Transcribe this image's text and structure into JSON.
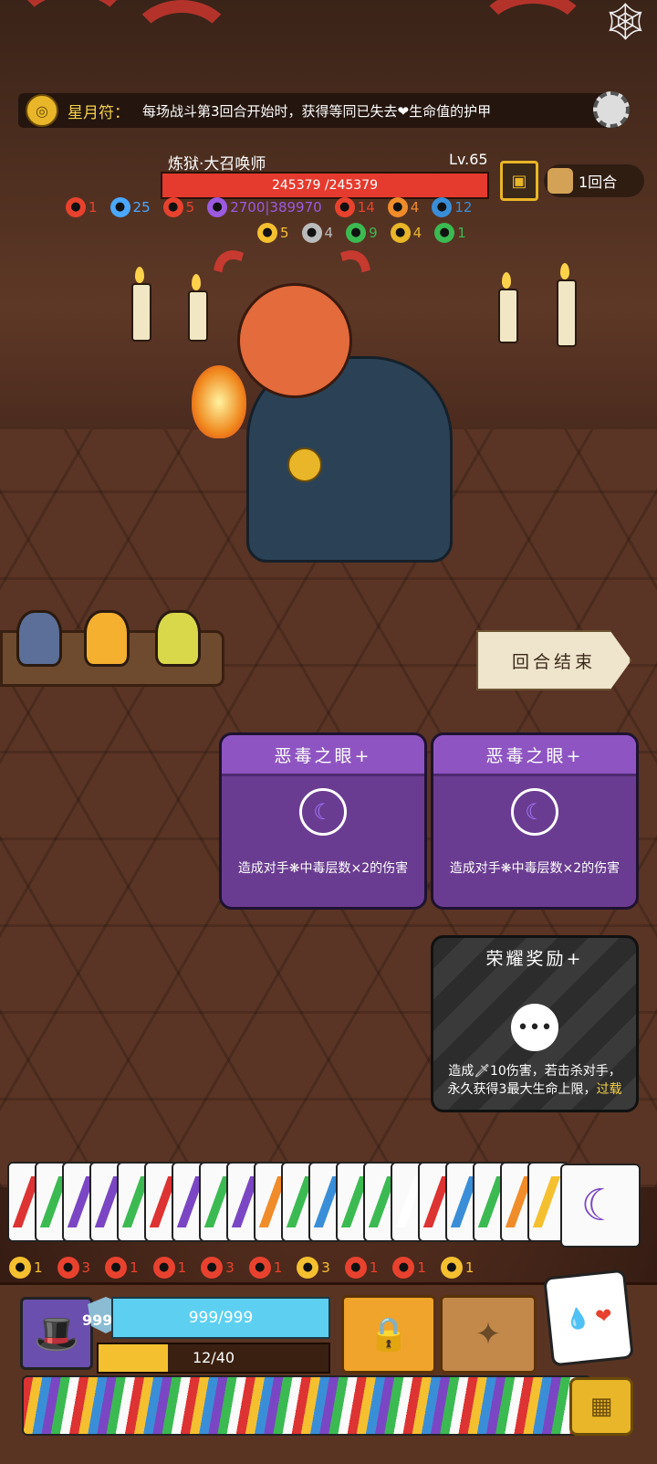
{
  "top_banner": {
    "label": "星月符：",
    "text": "每场战斗第3回合开始时，获得等同已失去❤生命值的护甲"
  },
  "enemy": {
    "name": "炼狱·大召唤师",
    "level": "Lv.65",
    "hp": "245379 /245379"
  },
  "turn": {
    "label": "1回合"
  },
  "enemy_status_row1": [
    {
      "icon": "spiral-icon",
      "color": "#e8422e",
      "value": "1"
    },
    {
      "icon": "snowflake-icon",
      "color": "#4aa8ff",
      "value": "25"
    },
    {
      "icon": "devil-icon",
      "color": "#e8422e",
      "value": "5"
    },
    {
      "icon": "splat-icon",
      "color": "#9b5ae0",
      "value": "2700|389970"
    },
    {
      "icon": "flame-icon",
      "color": "#e8422e",
      "value": "14"
    },
    {
      "icon": "fire-orange-icon",
      "color": "#f08c2a",
      "value": "4"
    },
    {
      "icon": "blue-mask-icon",
      "color": "#3a8ed8",
      "value": "12"
    }
  ],
  "enemy_status_row2": [
    {
      "icon": "triangle-icon",
      "color": "#f5c030",
      "value": "5"
    },
    {
      "icon": "skull-icon",
      "color": "#bbbbbb",
      "value": "4"
    },
    {
      "icon": "green-swirl-icon",
      "color": "#3cba52",
      "value": "9"
    },
    {
      "icon": "lock-icon",
      "color": "#e8b628",
      "value": "4"
    },
    {
      "icon": "green-bolt-icon",
      "color": "#3cba52",
      "value": "1"
    }
  ],
  "end_turn_label": "回合结束",
  "cards": [
    {
      "title": "恶毒之眼+",
      "icon": "crescent-moon-icon",
      "desc": "造成对手❋中毒层数×2的伤害"
    },
    {
      "title": "恶毒之眼+",
      "icon": "crescent-moon-icon",
      "desc": "造成对手❋中毒层数×2的伤害"
    }
  ],
  "honor_card": {
    "title": "荣耀奖励+",
    "icon": "ellipsis-icon",
    "desc": "造成🗡10伤害，若击杀对手，永久获得3最大生命上限，",
    "keyword": "过载"
  },
  "player_buffs": [
    {
      "icon": "shield-icon",
      "color": "#f5c030",
      "value": "1"
    },
    {
      "icon": "heart-icon",
      "color": "#e8422e",
      "value": "3"
    },
    {
      "icon": "target-icon",
      "color": "#e8422e",
      "value": "1"
    },
    {
      "icon": "sword-plus-icon",
      "color": "#e8422e",
      "value": "1"
    },
    {
      "icon": "crack-icon",
      "color": "#e8422e",
      "value": "3"
    },
    {
      "icon": "spiral-icon",
      "color": "#e8422e",
      "value": "1"
    },
    {
      "icon": "shield-gold-icon",
      "color": "#f5c030",
      "value": "3"
    },
    {
      "icon": "red-swirl-icon",
      "color": "#e8422e",
      "value": "1"
    },
    {
      "icon": "sword-slash-icon",
      "color": "#e8422e",
      "value": "1"
    },
    {
      "icon": "claw-icon",
      "color": "#f5c030",
      "value": "1"
    }
  ],
  "player": {
    "shield": "99999",
    "hp": "999/999",
    "energy": "12/40",
    "energy_fraction": 0.3
  }
}
